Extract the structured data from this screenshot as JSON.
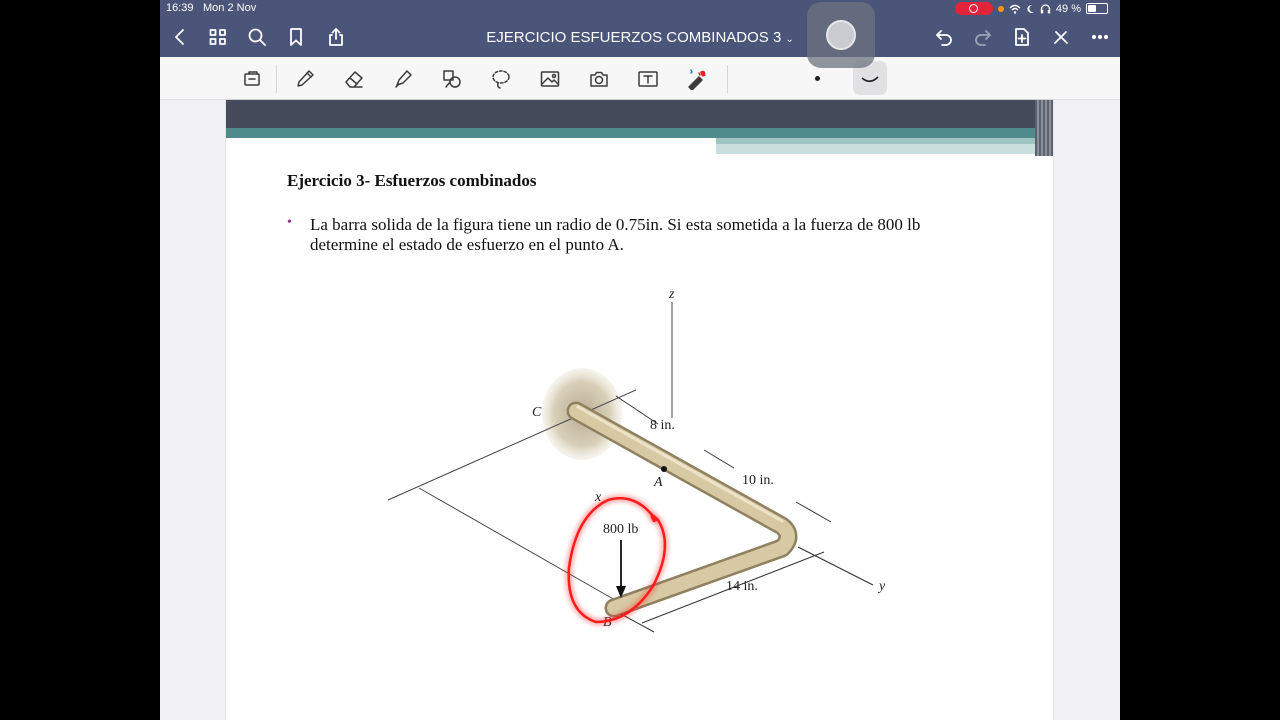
{
  "status": {
    "time": "16:39",
    "date": "Mon 2 Nov",
    "battery": "49 %",
    "battery_level": 0.49
  },
  "nav": {
    "title": "EJERCICIO ESFUERZOS COMBINADOS 3",
    "title_chevron": "⌄"
  },
  "toolbar": {
    "tools": [
      "reading-mode",
      "pen",
      "eraser",
      "highlighter",
      "shapes",
      "lasso",
      "image",
      "camera",
      "text",
      "laser-pointer"
    ]
  },
  "document": {
    "heading": "Ejercicio 3- Esfuerzos combinados",
    "bullet": "•",
    "paragraph": "La barra solida de la figura tiene un radio de 0.75in. Si esta sometida a la fuerza de 800 lb determine el estado de esfuerzo en el punto A.",
    "figure": {
      "axis_z": "z",
      "axis_x": "x",
      "axis_y": "y",
      "point_c": "C",
      "point_a": "A",
      "point_b": "B",
      "dim_8": "8 in.",
      "dim_10": "10 in.",
      "dim_14": "14 in.",
      "force": "800 lb"
    }
  },
  "colors": {
    "nav_bar": "#4a5579",
    "annotation": "#ff1a1a",
    "rod": "#c9b98f"
  }
}
